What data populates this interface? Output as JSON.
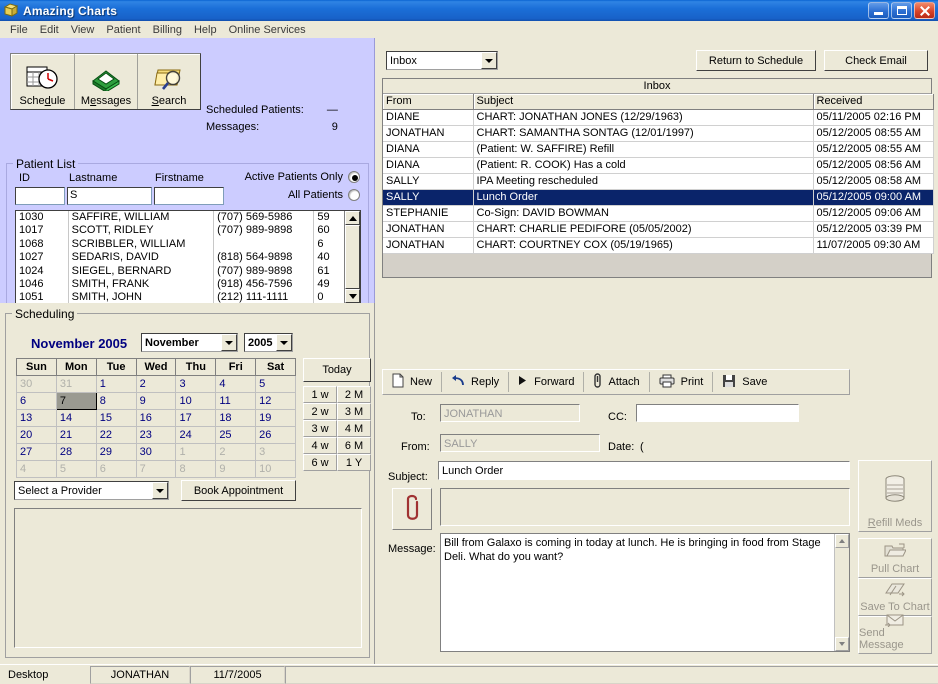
{
  "window": {
    "title": "Amazing Charts",
    "app_icon": "charts-icon",
    "buttons": {
      "minimize": "minimize-icon",
      "maximize": "maximize-icon",
      "close": "close-icon"
    }
  },
  "menubar": {
    "items": [
      "File",
      "Edit",
      "View",
      "Patient",
      "Billing",
      "Help",
      "Online Services"
    ]
  },
  "toolbar": {
    "buttons": [
      {
        "label": "Schedule",
        "accel": "d",
        "icon": "calendar-clock-icon"
      },
      {
        "label": "Messages",
        "accel": "e",
        "icon": "inbox-tray-icon"
      },
      {
        "label": "Search",
        "accel": "S",
        "icon": "folder-search-icon"
      }
    ]
  },
  "counts": {
    "scheduled_label": "Scheduled Patients:",
    "scheduled_value": "—",
    "messages_label": "Messages:",
    "messages_value": "9"
  },
  "patient_list": {
    "title": "Patient List",
    "labels": {
      "id": "ID",
      "lastname": "Lastname",
      "firstname": "Firstname"
    },
    "values": {
      "id": "",
      "lastname": "S",
      "firstname": ""
    },
    "radio": {
      "active_label": "Active Patients Only",
      "all_label": "All Patients",
      "selected": "active"
    },
    "rows": [
      {
        "id": "1030",
        "name": "SAFFIRE, WILLIAM",
        "phone": "(707) 569-5986",
        "age": "59"
      },
      {
        "id": "1017",
        "name": "SCOTT, RIDLEY",
        "phone": "(707) 989-9898",
        "age": "60"
      },
      {
        "id": "1068",
        "name": "SCRIBBLER, WILLIAM",
        "phone": "",
        "age": "6"
      },
      {
        "id": "1027",
        "name": "SEDARIS, DAVID",
        "phone": "(818) 564-9898",
        "age": "40"
      },
      {
        "id": "1024",
        "name": "SIEGEL, BERNARD",
        "phone": "(707) 989-9898",
        "age": "61"
      },
      {
        "id": "1046",
        "name": "SMITH, FRANK",
        "phone": "(918) 456-7596",
        "age": "49"
      },
      {
        "id": "1051",
        "name": "SMITH, JOHN",
        "phone": "(212) 111-1111",
        "age": "0"
      }
    ],
    "tools": [
      "new-chart-icon",
      "open-folder-icon",
      "printer-icon",
      "binoculars-icon",
      "delete-icon"
    ]
  },
  "scheduling": {
    "title": "Scheduling",
    "month_title": "November 2005",
    "month_select": "November",
    "year_select": "2005",
    "weekdays": [
      "Sun",
      "Mon",
      "Tue",
      "Wed",
      "Thu",
      "Fri",
      "Sat"
    ],
    "weeks": [
      [
        {
          "d": "30",
          "dim": true
        },
        {
          "d": "31",
          "dim": true
        },
        {
          "d": "1"
        },
        {
          "d": "2"
        },
        {
          "d": "3"
        },
        {
          "d": "4"
        },
        {
          "d": "5"
        }
      ],
      [
        {
          "d": "6"
        },
        {
          "d": "7",
          "sel": true
        },
        {
          "d": "8"
        },
        {
          "d": "9"
        },
        {
          "d": "10"
        },
        {
          "d": "11"
        },
        {
          "d": "12"
        }
      ],
      [
        {
          "d": "13"
        },
        {
          "d": "14"
        },
        {
          "d": "15"
        },
        {
          "d": "16"
        },
        {
          "d": "17"
        },
        {
          "d": "18"
        },
        {
          "d": "19"
        }
      ],
      [
        {
          "d": "20"
        },
        {
          "d": "21"
        },
        {
          "d": "22"
        },
        {
          "d": "23"
        },
        {
          "d": "24"
        },
        {
          "d": "25"
        },
        {
          "d": "26"
        }
      ],
      [
        {
          "d": "27"
        },
        {
          "d": "28"
        },
        {
          "d": "29"
        },
        {
          "d": "30"
        },
        {
          "d": "1",
          "dim": true
        },
        {
          "d": "2",
          "dim": true
        },
        {
          "d": "3",
          "dim": true
        }
      ],
      [
        {
          "d": "4",
          "dim": true
        },
        {
          "d": "5",
          "dim": true
        },
        {
          "d": "6",
          "dim": true
        },
        {
          "d": "7",
          "dim": true
        },
        {
          "d": "8",
          "dim": true
        },
        {
          "d": "9",
          "dim": true
        },
        {
          "d": "10",
          "dim": true
        }
      ]
    ],
    "today_label": "Today",
    "range_buttons": [
      "1 w",
      "2 M",
      "2 w",
      "3 M",
      "3 w",
      "4 M",
      "4 w",
      "6 M",
      "6 w",
      "1 Y"
    ],
    "provider_select": "Select a Provider",
    "book_label": "Book Appointment"
  },
  "mail": {
    "folder_select": "Inbox",
    "return_label": "Return to Schedule",
    "check_label": "Check Email",
    "inbox_caption": "Inbox",
    "columns": [
      "From",
      "Subject",
      "Received"
    ],
    "messages": [
      {
        "from": "DIANE",
        "subject": "CHART: JONATHAN JONES (12/29/1963)",
        "received": "05/11/2005 02:16 PM",
        "selected": false
      },
      {
        "from": "JONATHAN",
        "subject": "CHART: SAMANTHA SONTAG (12/01/1997)",
        "received": "05/12/2005 08:55 AM",
        "selected": false
      },
      {
        "from": "DIANA",
        "subject": "(Patient: W. SAFFIRE) Refill",
        "received": "05/12/2005 08:55 AM",
        "selected": false
      },
      {
        "from": "DIANA",
        "subject": "(Patient: R. COOK) Has a cold",
        "received": "05/12/2005 08:56 AM",
        "selected": false
      },
      {
        "from": "SALLY",
        "subject": "IPA Meeting rescheduled",
        "received": "05/12/2005 08:58 AM",
        "selected": false
      },
      {
        "from": "SALLY",
        "subject": "Lunch Order",
        "received": "05/12/2005 09:00 AM",
        "selected": true
      },
      {
        "from": "STEPHANIE",
        "subject": "Co-Sign: DAVID BOWMAN",
        "received": "05/12/2005 09:06 AM",
        "selected": false
      },
      {
        "from": "JONATHAN",
        "subject": "CHART: CHARLIE PEDIFORE (05/05/2002)",
        "received": "05/12/2005 03:39 PM",
        "selected": false
      },
      {
        "from": "JONATHAN",
        "subject": "CHART: COURTNEY COX (05/19/1965)",
        "received": "11/07/2005 09:30 AM",
        "selected": false
      }
    ],
    "toolbar": [
      {
        "label": "New",
        "icon": "new-document-icon"
      },
      {
        "label": "Reply",
        "icon": "reply-arrow-icon"
      },
      {
        "label": "Forward",
        "icon": "forward-triangle-icon"
      },
      {
        "label": "Attach",
        "icon": "paperclip-icon"
      },
      {
        "label": "Print",
        "icon": "printer-icon"
      },
      {
        "label": "Save",
        "icon": "floppy-disk-icon"
      }
    ],
    "compose": {
      "to_label": "To:",
      "to_value": "JONATHAN",
      "cc_label": "CC:",
      "cc_value": "",
      "from_label": "From:",
      "from_value": "SALLY",
      "date_label": "Date:",
      "date_value": "(",
      "subject_label": "Subject:",
      "subject_value": "Lunch Order",
      "message_label": "Message:",
      "message_value": "Bill from Galaxo is coming in today at lunch. He is bringing in food from Stage Deli. What do you want?",
      "attach_icon": "paperclip-icon",
      "attachment_value": ""
    },
    "side_buttons": [
      {
        "label": "Refill Meds",
        "accel": "R",
        "icon": "pill-bottle-icon"
      },
      {
        "label": "Pull Chart",
        "icon": "open-folder-icon"
      },
      {
        "label": "Save To Chart",
        "icon": "save-chart-icon"
      },
      {
        "label": "Send Message",
        "icon": "send-envelope-icon"
      }
    ]
  },
  "statusbar": {
    "desktop": "Desktop",
    "user": "JONATHAN",
    "date": "11/7/2005"
  }
}
